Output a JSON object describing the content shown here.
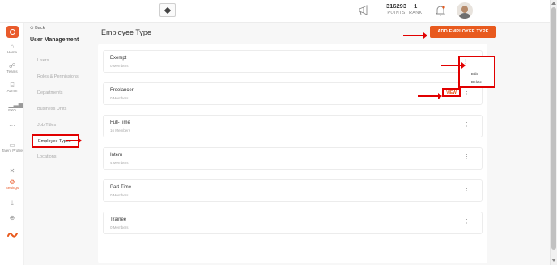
{
  "topbar": {
    "points_value": "316293",
    "points_label": "POINTS",
    "rank_value": "1",
    "rank_label": "RANK"
  },
  "rail": [
    {
      "label": "Home",
      "icon": "home-icon"
    },
    {
      "label": "Teams",
      "icon": "people-icon"
    },
    {
      "label": "Admin",
      "icon": "bank-icon"
    },
    {
      "label": "EXO",
      "icon": "bar-chart-icon"
    },
    {
      "label": "",
      "icon": "more-icon"
    },
    {
      "label": "Talent Profile",
      "icon": "id-card-icon"
    },
    {
      "label": "",
      "icon": "tools-icon"
    },
    {
      "label": "Settings",
      "icon": "gear-icon"
    },
    {
      "label": "",
      "icon": "download-icon"
    },
    {
      "label": "",
      "icon": "support-icon"
    }
  ],
  "menu": {
    "back_label": "Back",
    "title": "User Management",
    "items": [
      "Users",
      "Roles & Permissions",
      "Departments",
      "Business Units",
      "Job Titles",
      "Employee Types",
      "Locations"
    ]
  },
  "main": {
    "title": "Employee Type",
    "add_button": "ADD EMPLOYEE TYPE",
    "view_button": "VIEW",
    "kebab": "⋮",
    "cards": [
      {
        "name": "Exempt",
        "count": "0 Members"
      },
      {
        "name": "Freelancer",
        "count": "0 Members"
      },
      {
        "name": "Full-Time",
        "count": "16 Members"
      },
      {
        "name": "Intern",
        "count": "4 Members"
      },
      {
        "name": "Part-Time",
        "count": "0 Members"
      },
      {
        "name": "Trainee",
        "count": "0 Members"
      }
    ],
    "dropdown": {
      "edit": "Edit",
      "delete": "Delete"
    }
  },
  "colors": {
    "accent": "#e85a1e",
    "annotation": "#e10000"
  }
}
